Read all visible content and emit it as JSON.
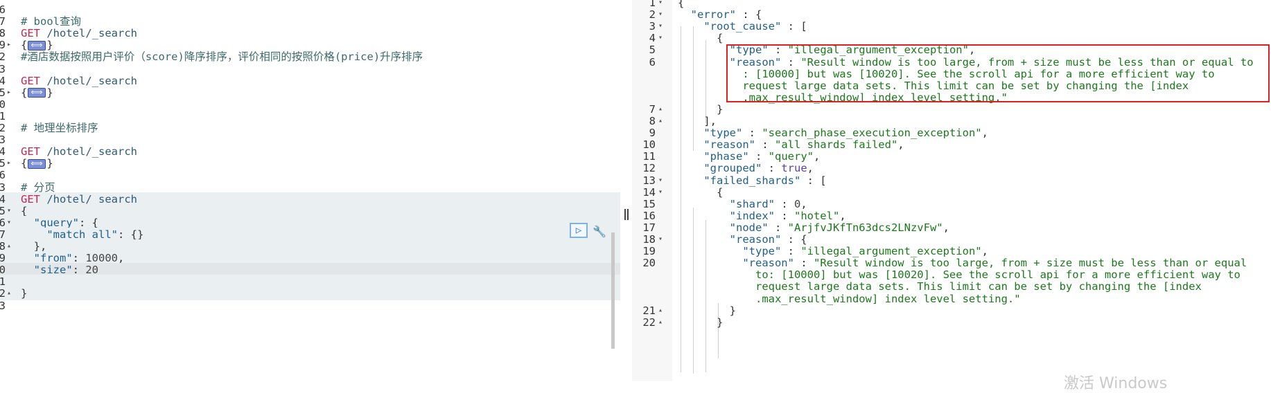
{
  "editor": {
    "lines": [
      {
        "n": "6",
        "fold": "",
        "tokens": []
      },
      {
        "n": "7",
        "fold": "",
        "tokens": [
          [
            "comment",
            "# bool查询"
          ]
        ]
      },
      {
        "n": "8",
        "fold": "",
        "tokens": [
          [
            "method",
            "GET"
          ],
          [
            "path",
            " /hotel/_search"
          ]
        ]
      },
      {
        "n": "9",
        "fold": "▸",
        "tokens": [
          [
            "punc",
            "{"
          ],
          [
            "collapsed",
            ""
          ],
          [
            "punc",
            "}"
          ]
        ]
      },
      {
        "n": "2",
        "fold": "",
        "tokens": [
          [
            "comment",
            "#酒店数据按照用户评价（score)降序排序，评价相同的按照价格(price)升序排序"
          ]
        ]
      },
      {
        "n": "3",
        "fold": "",
        "tokens": []
      },
      {
        "n": "4",
        "fold": "",
        "tokens": [
          [
            "method",
            "GET"
          ],
          [
            "path",
            " /hotel/_search"
          ]
        ]
      },
      {
        "n": "5",
        "fold": "▸",
        "tokens": [
          [
            "punc",
            "{"
          ],
          [
            "collapsed",
            ""
          ],
          [
            "punc",
            "}"
          ]
        ]
      },
      {
        "n": "0",
        "fold": "",
        "tokens": []
      },
      {
        "n": "1",
        "fold": "",
        "tokens": []
      },
      {
        "n": "2",
        "fold": "",
        "tokens": [
          [
            "comment",
            "# 地理坐标排序"
          ]
        ]
      },
      {
        "n": "3",
        "fold": "",
        "tokens": []
      },
      {
        "n": "4",
        "fold": "",
        "tokens": [
          [
            "method",
            "GET"
          ],
          [
            "path",
            " /hotel/_search"
          ]
        ]
      },
      {
        "n": "5",
        "fold": "▸",
        "tokens": [
          [
            "punc",
            "{"
          ],
          [
            "collapsed",
            ""
          ],
          [
            "punc",
            "}"
          ]
        ]
      },
      {
        "n": "6",
        "fold": "",
        "tokens": []
      },
      {
        "n": "3",
        "fold": "",
        "tokens": [
          [
            "comment",
            "# 分页"
          ]
        ]
      },
      {
        "n": "4",
        "fold": "",
        "hl": 1,
        "tokens": [
          [
            "method",
            "GET"
          ],
          [
            "path",
            " /hotel/_search"
          ]
        ]
      },
      {
        "n": "5",
        "fold": "▾",
        "hl": 1,
        "tokens": [
          [
            "punc",
            "{"
          ]
        ]
      },
      {
        "n": "6",
        "fold": "▾",
        "hl": 1,
        "tokens": [
          [
            "key",
            "  \"query\""
          ],
          [
            "punc",
            ": {"
          ]
        ]
      },
      {
        "n": "7",
        "fold": "",
        "hl": 1,
        "tokens": [
          [
            "key",
            "    \"match_all\""
          ],
          [
            "punc",
            ": {}"
          ]
        ]
      },
      {
        "n": "8",
        "fold": "▴",
        "hl": 1,
        "tokens": [
          [
            "punc",
            "  },"
          ]
        ]
      },
      {
        "n": "9",
        "fold": "",
        "hl": 1,
        "tokens": [
          [
            "key",
            "  \"from\""
          ],
          [
            "punc",
            ": "
          ],
          [
            "num",
            "10000"
          ],
          [
            "punc",
            ","
          ]
        ]
      },
      {
        "n": "0",
        "fold": "",
        "hl": 2,
        "tokens": [
          [
            "key",
            "  \"size\""
          ],
          [
            "punc",
            ": "
          ],
          [
            "num",
            "20"
          ]
        ]
      },
      {
        "n": "1",
        "fold": "",
        "hl": 1,
        "tokens": []
      },
      {
        "n": "2",
        "fold": "▴",
        "hl": 1,
        "tokens": [
          [
            "punc",
            "}"
          ]
        ]
      },
      {
        "n": "3",
        "fold": "",
        "tokens": []
      }
    ]
  },
  "response": {
    "lines": [
      {
        "n": "1",
        "fold": "▾",
        "tokens": [
          [
            "punc",
            "{"
          ]
        ]
      },
      {
        "n": "2",
        "fold": "▾",
        "tokens": [
          [
            "key",
            "  \"error\""
          ],
          [
            "punc",
            " : {"
          ]
        ]
      },
      {
        "n": "3",
        "fold": "▾",
        "tokens": [
          [
            "key",
            "    \"root_cause\""
          ],
          [
            "punc",
            " : ["
          ]
        ]
      },
      {
        "n": "4",
        "fold": "▾",
        "tokens": [
          [
            "punc",
            "      {"
          ]
        ]
      },
      {
        "n": "5",
        "fold": "",
        "tokens": [
          [
            "key",
            "        \"type\""
          ],
          [
            "punc",
            " : "
          ],
          [
            "str",
            "\"illegal_argument_exception\""
          ],
          [
            "punc",
            ","
          ]
        ]
      },
      {
        "n": "6",
        "fold": "",
        "tokens": [
          [
            "key",
            "        \"reason\""
          ],
          [
            "punc",
            " : "
          ],
          [
            "str",
            "\"Result window is too large, from + size must be less than or equal to"
          ]
        ]
      },
      {
        "n": "",
        "fold": "",
        "tokens": [
          [
            "str",
            "          : [10000] but was [10020]. See the scroll api for a more efficient way to"
          ]
        ]
      },
      {
        "n": "",
        "fold": "",
        "tokens": [
          [
            "str",
            "          request large data sets. This limit can be set by changing the [index"
          ]
        ]
      },
      {
        "n": "",
        "fold": "",
        "tokens": [
          [
            "str",
            "          .max_result_window] index level setting.\""
          ]
        ]
      },
      {
        "n": "7",
        "fold": "▴",
        "tokens": [
          [
            "punc",
            "      }"
          ]
        ]
      },
      {
        "n": "8",
        "fold": "▴",
        "tokens": [
          [
            "punc",
            "    ],"
          ]
        ]
      },
      {
        "n": "9",
        "fold": "",
        "tokens": [
          [
            "key",
            "    \"type\""
          ],
          [
            "punc",
            " : "
          ],
          [
            "str",
            "\"search_phase_execution_exception\""
          ],
          [
            "punc",
            ","
          ]
        ]
      },
      {
        "n": "10",
        "fold": "",
        "tokens": [
          [
            "key",
            "    \"reason\""
          ],
          [
            "punc",
            " : "
          ],
          [
            "str",
            "\"all shards failed\""
          ],
          [
            "punc",
            ","
          ]
        ]
      },
      {
        "n": "11",
        "fold": "",
        "tokens": [
          [
            "key",
            "    \"phase\""
          ],
          [
            "punc",
            " : "
          ],
          [
            "str",
            "\"query\""
          ],
          [
            "punc",
            ","
          ]
        ]
      },
      {
        "n": "12",
        "fold": "",
        "tokens": [
          [
            "key",
            "    \"grouped\""
          ],
          [
            "punc",
            " : "
          ],
          [
            "bool",
            "true"
          ],
          [
            "punc",
            ","
          ]
        ]
      },
      {
        "n": "13",
        "fold": "▾",
        "tokens": [
          [
            "key",
            "    \"failed_shards\""
          ],
          [
            "punc",
            " : ["
          ]
        ]
      },
      {
        "n": "14",
        "fold": "▾",
        "tokens": [
          [
            "punc",
            "      {"
          ]
        ]
      },
      {
        "n": "15",
        "fold": "",
        "tokens": [
          [
            "key",
            "        \"shard\""
          ],
          [
            "punc",
            " : "
          ],
          [
            "num",
            "0"
          ],
          [
            "punc",
            ","
          ]
        ]
      },
      {
        "n": "16",
        "fold": "",
        "tokens": [
          [
            "key",
            "        \"index\""
          ],
          [
            "punc",
            " : "
          ],
          [
            "str",
            "\"hotel\""
          ],
          [
            "punc",
            ","
          ]
        ]
      },
      {
        "n": "17",
        "fold": "",
        "tokens": [
          [
            "key",
            "        \"node\""
          ],
          [
            "punc",
            " : "
          ],
          [
            "str",
            "\"ArjfvJKfTn63dcs2LNzvFw\""
          ],
          [
            "punc",
            ","
          ]
        ]
      },
      {
        "n": "18",
        "fold": "▾",
        "tokens": [
          [
            "key",
            "        \"reason\""
          ],
          [
            "punc",
            " : {"
          ]
        ]
      },
      {
        "n": "19",
        "fold": "",
        "tokens": [
          [
            "key",
            "          \"type\""
          ],
          [
            "punc",
            " : "
          ],
          [
            "str",
            "\"illegal_argument_exception\""
          ],
          [
            "punc",
            ","
          ]
        ]
      },
      {
        "n": "20",
        "fold": "",
        "tokens": [
          [
            "key",
            "          \"reason\""
          ],
          [
            "punc",
            " : "
          ],
          [
            "str",
            "\"Result window is too large, from + size must be less than or equal"
          ]
        ]
      },
      {
        "n": "",
        "fold": "",
        "tokens": [
          [
            "str",
            "            to: [10000] but was [10020]. See the scroll api for a more efficient way to"
          ]
        ]
      },
      {
        "n": "",
        "fold": "",
        "tokens": [
          [
            "str",
            "            request large data sets. This limit can be set by changing the [index"
          ]
        ]
      },
      {
        "n": "",
        "fold": "",
        "tokens": [
          [
            "str",
            "            .max_result_window] index level setting.\""
          ]
        ]
      },
      {
        "n": "21",
        "fold": "▴",
        "tokens": [
          [
            "punc",
            "        }"
          ]
        ]
      },
      {
        "n": "22",
        "fold": "▴",
        "tokens": [
          [
            "punc",
            "      }"
          ]
        ]
      }
    ]
  },
  "watermark": "激活 Windows",
  "icons": {
    "run": "play-icon",
    "wrench": "wrench-icon"
  },
  "colors": {
    "highlight_box": "#e02020",
    "method": "#c7254e",
    "string": "#1a7a1a"
  }
}
